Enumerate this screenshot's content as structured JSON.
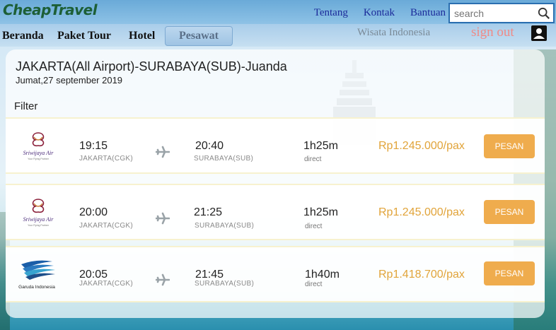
{
  "header": {
    "logo": "CheapTravel",
    "links": [
      "Tentang",
      "Kontak",
      "Bantuan"
    ],
    "search_placeholder": "search"
  },
  "nav": {
    "items": [
      "Beranda",
      "Paket Tour",
      "Hotel"
    ],
    "active": "Pesawat",
    "wisata": "Wisata Indonesia",
    "signout": "sign out"
  },
  "search_result": {
    "route": "JAKARTA(All Airport)-SURABAYA(SUB)-Juanda",
    "date": "Jumat,27 september 2019",
    "filter_label": "Filter"
  },
  "flights": [
    {
      "airline": "Sriwijaya Air",
      "airline_tagline": "Your Flying Partner",
      "depart_time": "19:15",
      "depart_code": "JAKARTA(CGK)",
      "arrive_time": "20:40",
      "arrive_code": "SURABAYA(SUB)",
      "duration": "1h25m",
      "type": "direct",
      "price": "Rp1.245.000/pax",
      "button": "PESAN"
    },
    {
      "airline": "Sriwijaya Air",
      "airline_tagline": "Your Flying Partner",
      "depart_time": "20:00",
      "depart_code": "JAKARTA(CGK)",
      "arrive_time": "21:25",
      "arrive_code": "SURABAYA(SUB)",
      "duration": "1h25m",
      "type": "direct",
      "price": "Rp1.245.000/pax",
      "button": "PESAN"
    },
    {
      "airline": "Garuda Indonesia",
      "airline_tagline": "",
      "depart_time": "20:05",
      "depart_code": "JAKARTA(CGK)",
      "arrive_time": "21:45",
      "arrive_code": "SURABAYA(SUB)",
      "duration": "1h40m",
      "type": "direct",
      "price": "Rp1.418.700/pax",
      "button": "PESAN"
    }
  ],
  "colors": {
    "price": "#e1a43a",
    "button": "#efac4d",
    "signout": "#f08a86",
    "link": "#1b2a9a"
  }
}
